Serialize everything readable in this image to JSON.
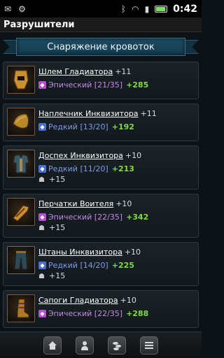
{
  "status_bar": {
    "time": "0:42",
    "icons": [
      "mail-icon",
      "android-debug-icon",
      "bluetooth-icon",
      "wifi-icon",
      "signal-icon",
      "battery-icon"
    ]
  },
  "app": {
    "title": "Разрушители"
  },
  "banner": {
    "title": "Снаряжение кроватоk"
  },
  "items": [
    {
      "name": "Шлем Гладиатора",
      "level": "+11",
      "rarity": "Эпический [21/35]",
      "rarity_type": "epic",
      "bonus": "+285",
      "extra": ""
    },
    {
      "name": "Наплечник Инквизитора",
      "level": "+11",
      "rarity": "Редкий [13/20]",
      "rarity_type": "rare",
      "bonus": "+192",
      "extra": ""
    },
    {
      "name": "Доспех Инквизитора",
      "level": "+10",
      "rarity": "Редкий [11/20]",
      "rarity_type": "rare",
      "bonus": "+213",
      "extra": "+15"
    },
    {
      "name": "Перчатки Воителя",
      "level": "+10",
      "rarity": "Эпический [22/35]",
      "rarity_type": "epic",
      "bonus": "+342",
      "extra": "+15"
    },
    {
      "name": "Штаны Инквизитора",
      "level": "+10",
      "rarity": "Редкий [14/20]",
      "rarity_type": "rare",
      "bonus": "+225",
      "extra": "+15"
    },
    {
      "name": "Сапоги Гладиатора",
      "level": "+10",
      "rarity": "Эпический [22/35]",
      "rarity_type": "epic",
      "bonus": "+288",
      "extra": ""
    }
  ],
  "bottom_nav": [
    "home-icon",
    "profile-icon",
    "coins-icon",
    "menu-icon"
  ],
  "colors": {
    "epic": "#c489e6",
    "rare": "#7c9ce8",
    "bonus": "#7ddb3a",
    "banner": "#1f4d64"
  }
}
